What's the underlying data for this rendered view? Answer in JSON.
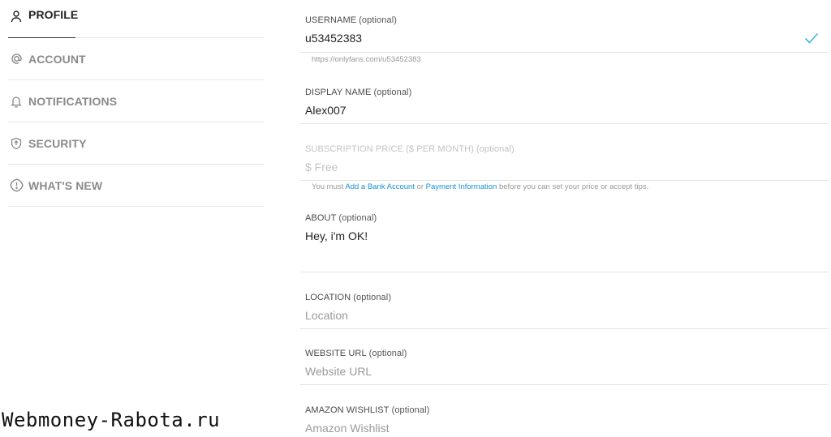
{
  "sidebar": {
    "items": [
      {
        "label": "PROFILE",
        "icon": "person-icon",
        "active": true
      },
      {
        "label": "ACCOUNT",
        "icon": "at-icon"
      },
      {
        "label": "NOTIFICATIONS",
        "icon": "bell-icon"
      },
      {
        "label": "SECURITY",
        "icon": "shield-icon"
      },
      {
        "label": "WHAT'S NEW",
        "icon": "alert-icon"
      }
    ]
  },
  "form": {
    "username": {
      "label": "USERNAME",
      "optional": "(optional)",
      "value": "u53452383",
      "hint": "https://onlyfans.com/u53452383"
    },
    "display_name": {
      "label": "DISPLAY NAME",
      "optional": "(optional)",
      "value": "Alex007"
    },
    "subscription": {
      "label": "SUBSCRIPTION PRICE ($ PER MONTH)",
      "optional": "(optional)",
      "placeholder": "$ Free",
      "hint_prefix": "You must ",
      "hint_link1": "Add a Bank Account",
      "hint_mid": " or ",
      "hint_link2": "Payment Information",
      "hint_suffix": " before you can set your price or accept tips."
    },
    "about": {
      "label": "ABOUT",
      "optional": "(optional)",
      "value": "Hey, i'm OK!"
    },
    "location": {
      "label": "LOCATION",
      "optional": "(optional)",
      "placeholder": "Location"
    },
    "website": {
      "label": "WEBSITE URL",
      "optional": "(optional)",
      "placeholder": "Website URL"
    },
    "wishlist": {
      "label": "AMAZON WISHLIST",
      "optional": "(optional)",
      "placeholder": "Amazon Wishlist"
    }
  },
  "watermark": "Webmoney-Rabota.ru",
  "colors": {
    "accent": "#1a8fd6",
    "check": "#3bb5e8"
  }
}
